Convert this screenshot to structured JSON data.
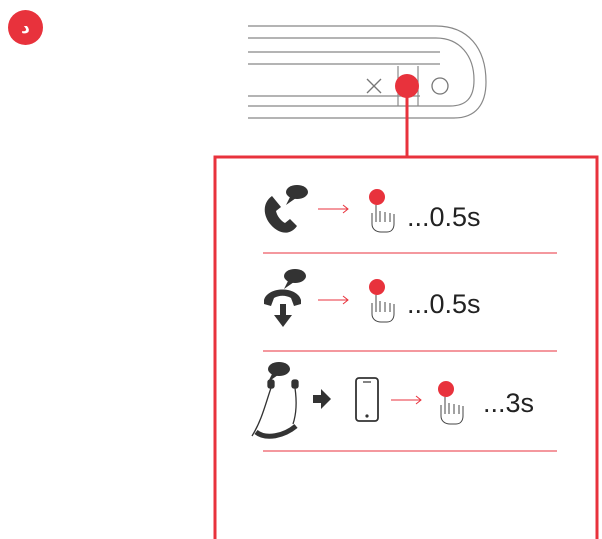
{
  "step": {
    "badge": "د"
  },
  "device": {
    "buttons": [
      "close-x",
      "press",
      "circle"
    ]
  },
  "actions": [
    {
      "name": "answer-call",
      "icons": [
        "speech-bubble-icon",
        "phone-answer-icon"
      ],
      "duration": "...0.5s"
    },
    {
      "name": "end-call",
      "icons": [
        "speech-bubble-icon",
        "phone-hangup-icon"
      ],
      "duration": "...0.5s"
    },
    {
      "name": "voice-assistant",
      "icons": [
        "speech-bubble-icon",
        "neckband-earphones-icon",
        "smartphone-icon"
      ],
      "duration": "...3s"
    }
  ],
  "colors": {
    "accent": "#e8323c",
    "outline": "#777777",
    "icon": "#333333"
  }
}
